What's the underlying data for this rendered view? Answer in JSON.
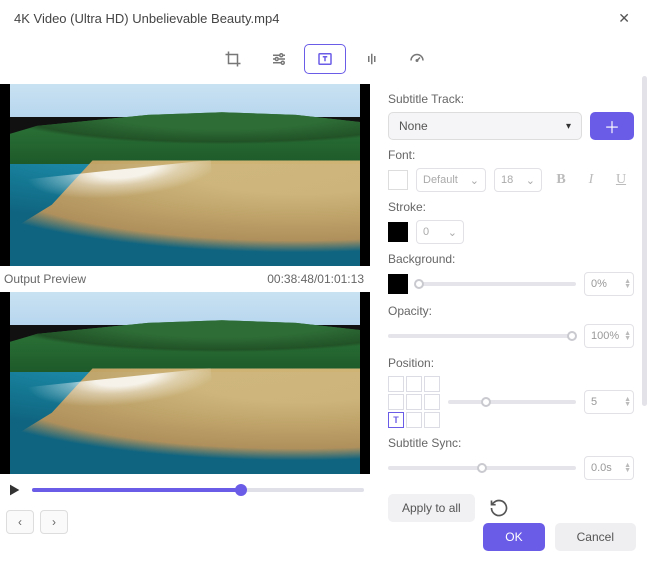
{
  "title": "4K Video (Ultra HD) Unbelievable Beauty.mp4",
  "preview": {
    "label": "Output Preview",
    "time": "00:38:48/01:01:13"
  },
  "subtitle_panel": {
    "track_label": "Subtitle Track:",
    "track_value": "None",
    "font_label": "Font:",
    "font_family": "Default",
    "font_size": "18",
    "stroke_label": "Stroke:",
    "stroke_value": "0",
    "background_label": "Background:",
    "background_value": "0%",
    "opacity_label": "Opacity:",
    "opacity_value": "100%",
    "position_label": "Position:",
    "position_value": "5",
    "position_cell_text": "T",
    "sync_label": "Subtitle Sync:",
    "sync_value": "0.0s",
    "apply_label": "Apply to all"
  },
  "buttons": {
    "ok": "OK",
    "cancel": "Cancel"
  }
}
